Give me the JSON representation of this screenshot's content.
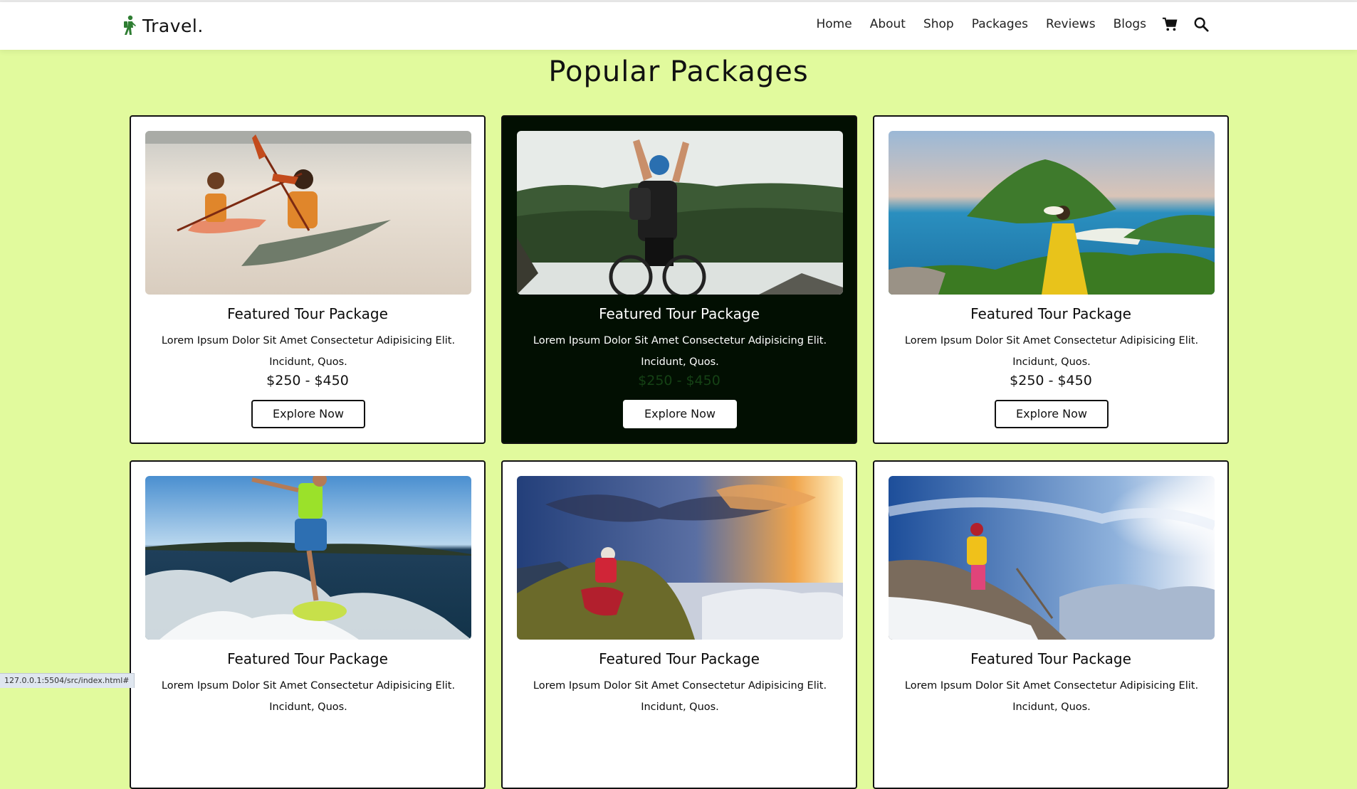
{
  "brand": {
    "name": "Travel."
  },
  "nav": {
    "items": [
      "Home",
      "About",
      "Shop",
      "Packages",
      "Reviews",
      "Blogs"
    ]
  },
  "section": {
    "title": "Popular Packages"
  },
  "packages": [
    {
      "title": "Featured Tour Package",
      "desc": "Lorem Ipsum Dolor Sit Amet Consectetur Adipisicing Elit. Incidunt, Quos.",
      "price": "$250 - $450",
      "cta": "Explore Now",
      "image": "kayaking-on-lake"
    },
    {
      "title": "Featured Tour Package",
      "desc": "Lorem Ipsum Dolor Sit Amet Consectetur Adipisicing Elit. Incidunt, Quos.",
      "price": "$250 - $450",
      "cta": "Explore Now",
      "image": "cyclist-arms-raised-above-forest"
    },
    {
      "title": "Featured Tour Package",
      "desc": "Lorem Ipsum Dolor Sit Amet Consectetur Adipisicing Elit. Incidunt, Quos.",
      "price": "$250 - $450",
      "cta": "Explore Now",
      "image": "woman-yellow-dress-tropical-island"
    },
    {
      "title": "Featured Tour Package",
      "desc": "Lorem Ipsum Dolor Sit Amet Consectetur Adipisicing Elit. Incidunt, Quos.",
      "price": "",
      "cta": "",
      "image": "wakesurfer-on-wave"
    },
    {
      "title": "Featured Tour Package",
      "desc": "Lorem Ipsum Dolor Sit Amet Consectetur Adipisicing Elit. Incidunt, Quos.",
      "price": "",
      "cta": "",
      "image": "hiker-photographing-sunset-mountains"
    },
    {
      "title": "Featured Tour Package",
      "desc": "Lorem Ipsum Dolor Sit Amet Consectetur Adipisicing Elit. Incidunt, Quos.",
      "price": "",
      "cta": "",
      "image": "hiker-on-snowy-peak"
    }
  ],
  "statusbar": {
    "url": "127.0.0.1:5504/src/index.html#"
  },
  "colors": {
    "page_bg": "#e1fa9d",
    "accent_green": "#2e7d32",
    "dark_card": "#020f02"
  }
}
